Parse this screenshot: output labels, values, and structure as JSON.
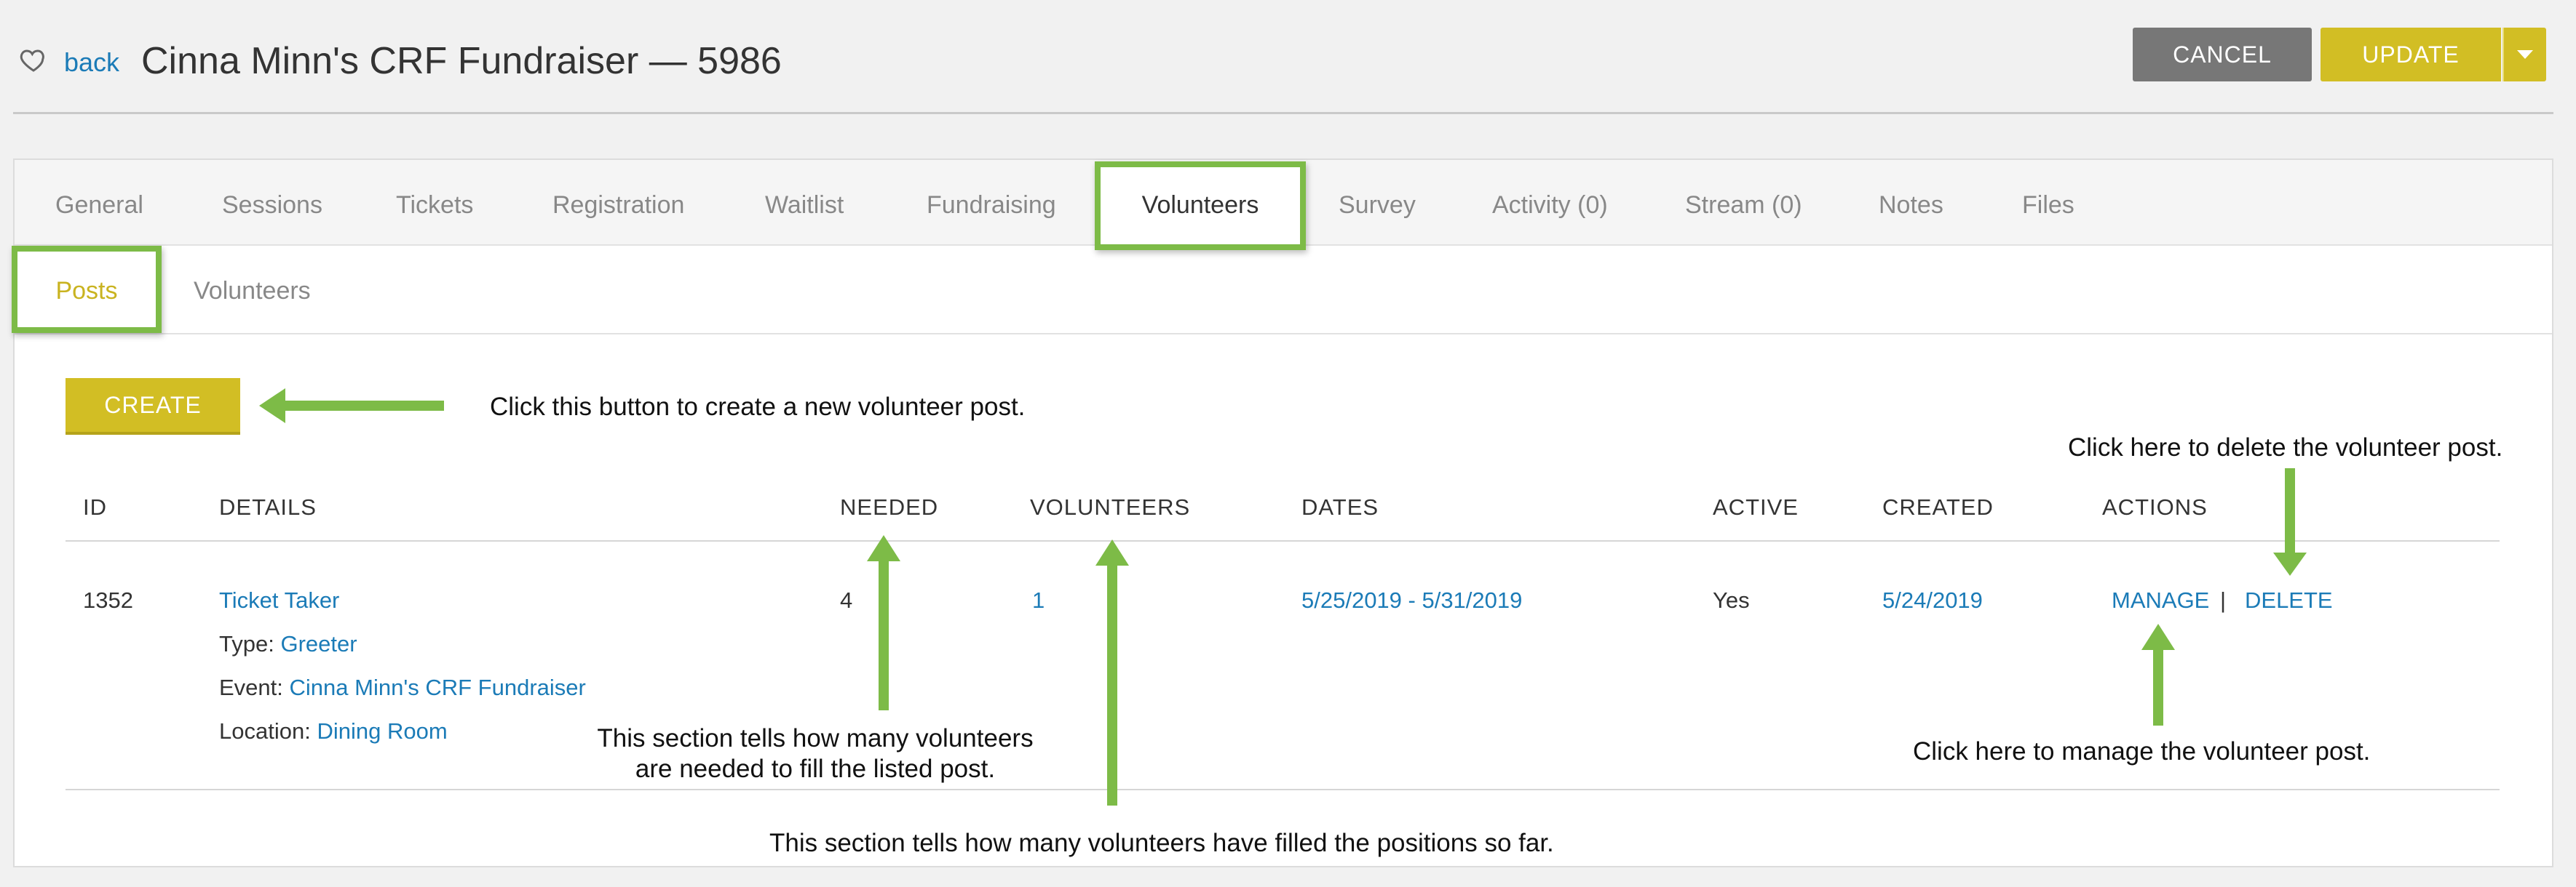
{
  "header": {
    "back_label": "back",
    "title": "Cinna Minn's CRF Fundraiser — 5986",
    "cancel_label": "CANCEL",
    "update_label": "UPDATE"
  },
  "tabs": [
    {
      "label": "General"
    },
    {
      "label": "Sessions"
    },
    {
      "label": "Tickets"
    },
    {
      "label": "Registration"
    },
    {
      "label": "Waitlist"
    },
    {
      "label": "Fundraising"
    },
    {
      "label": "Volunteers",
      "active": true
    },
    {
      "label": "Survey"
    },
    {
      "label": "Activity (0)"
    },
    {
      "label": "Stream (0)"
    },
    {
      "label": "Notes"
    },
    {
      "label": "Files"
    }
  ],
  "subtabs": [
    {
      "label": "Posts",
      "active": true
    },
    {
      "label": "Volunteers"
    }
  ],
  "create_label": "CREATE",
  "table": {
    "columns": [
      "ID",
      "DETAILS",
      "NEEDED",
      "VOLUNTEERS",
      "DATES",
      "ACTIVE",
      "CREATED",
      "ACTIONS"
    ],
    "rows": [
      {
        "id": "1352",
        "name": "Ticket Taker",
        "type_label": "Type:",
        "type_value": "Greeter",
        "event_label": "Event:",
        "event_value": "Cinna Minn's CRF Fundraiser",
        "location_label": "Location:",
        "location_value": "Dining Room",
        "needed": "4",
        "volunteers": "1",
        "dates": "5/25/2019 - 5/31/2019",
        "active": "Yes",
        "created": "5/24/2019",
        "manage_label": "MANAGE",
        "separator": "|",
        "delete_label": "DELETE"
      }
    ]
  },
  "annotations": {
    "create": "Click this button to create a new volunteer post.",
    "delete": "Click here to delete the volunteer post.",
    "needed_line1": "This section tells how many volunteers",
    "needed_line2": "are needed to fill the listed post.",
    "manage": "Click here to manage the volunteer post.",
    "volunteers": "This section tells how many volunteers have filled the positions so far."
  },
  "colors": {
    "accent": "#d2be24",
    "highlight_green": "#7dbb47",
    "link": "#1b7bb7",
    "cancel_gray": "#777777"
  },
  "icons": [
    "heart-icon",
    "caret-down-icon",
    "arrow-icon"
  ]
}
